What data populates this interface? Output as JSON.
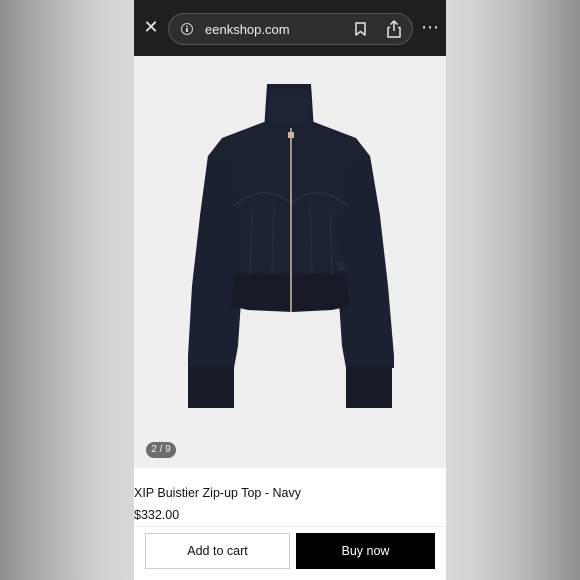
{
  "browser": {
    "url": "eenkshop.com",
    "close_icon": "close-icon",
    "info_icon": "info-icon",
    "bookmark_icon": "bookmark-icon",
    "share_icon": "share-icon",
    "more_icon": "more-icon"
  },
  "product": {
    "image_counter": "2 / 9",
    "name": "XIP Buistier Zip-up Top - Navy",
    "price": "$332.00",
    "colors": {
      "garment": "#1d2233",
      "image_background": "#efefef"
    }
  },
  "actions": {
    "add_to_cart": "Add to cart",
    "buy_now": "Buy now"
  }
}
